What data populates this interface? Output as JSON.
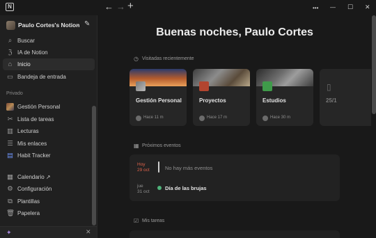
{
  "titlebar": {
    "logo": "N",
    "back": "←",
    "forward": "→",
    "new": "+",
    "more": "•••",
    "minimize": "—",
    "maximize": "☐",
    "close": "✕"
  },
  "sidebar": {
    "workspace_name": "Paulo Cortes's Notion",
    "top_items": [
      {
        "label": "Buscar",
        "icon": "search-icon"
      },
      {
        "label": "IA de Notion",
        "icon": "ai-icon"
      },
      {
        "label": "Inicio",
        "icon": "home-icon"
      },
      {
        "label": "Bandeja de entrada",
        "icon": "inbox-icon"
      }
    ],
    "section_label": "Privado",
    "private_items": [
      {
        "label": "Gestión Personal",
        "icon": "page-cover-icon"
      },
      {
        "label": "Lista de tareas",
        "icon": "tools-icon"
      },
      {
        "label": "Lecturas",
        "icon": "books-icon"
      },
      {
        "label": "Mis enlaces",
        "icon": "link-icon"
      },
      {
        "label": "Habit Tracker",
        "icon": "tracker-icon"
      }
    ],
    "bottom_items": [
      {
        "label": "Calendario ↗",
        "icon": "calendar-icon"
      },
      {
        "label": "Configuración",
        "icon": "gear-icon"
      },
      {
        "label": "Plantillas",
        "icon": "templates-icon"
      },
      {
        "label": "Papelera",
        "icon": "trash-icon"
      }
    ],
    "accent_color": "#a98be0"
  },
  "main": {
    "greeting": "Buenas noches, Paulo Cortes",
    "recent_title": "Visitadas recientemente",
    "recent_cards": [
      {
        "title": "Gestión Personal",
        "meta": "Hace 11 m"
      },
      {
        "title": "Proyectos",
        "meta": "Hace 17 m"
      },
      {
        "title": "Estudios",
        "meta": "Hace 30 m"
      },
      {
        "title": "25/1",
        "meta": ""
      }
    ],
    "events_title": "Próximos eventos",
    "events": [
      {
        "day": "Hoy",
        "date": "29 oct",
        "label": "No hay más eventos"
      },
      {
        "day": "jue",
        "date": "31 oct",
        "label": "Día de las brujas"
      }
    ],
    "tasks_title": "Mis tareas"
  }
}
